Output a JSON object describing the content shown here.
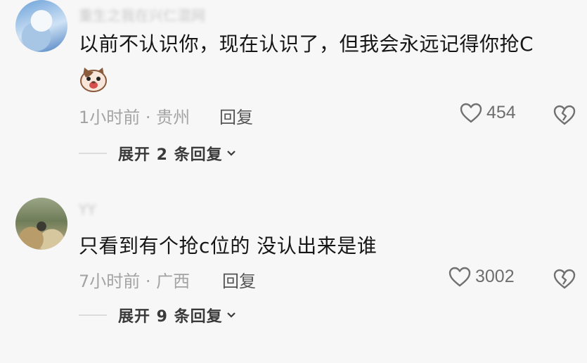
{
  "comments": [
    {
      "username": "重生之我在兴仁混网",
      "text": "以前不认识你，现在认识了，但我会永远记得你抢C",
      "has_emoji": true,
      "meta": "1小时前 · 贵州",
      "reply_label": "回复",
      "like_count": "454",
      "expand_label": "展开 2 条回复"
    },
    {
      "username": "YY",
      "text": "只看到有个抢c位的 没认出来是谁",
      "has_emoji": false,
      "meta": "7小时前 · 广西",
      "reply_label": "回复",
      "like_count": "3002",
      "expand_label": "展开 9 条回复"
    }
  ],
  "icons": {
    "like": "heart-outline-icon",
    "dislike": "broken-heart-icon",
    "expand": "chevron-down-icon",
    "emoji": "cat-face-emoji-icon"
  },
  "colors": {
    "background": "#f7f7f7",
    "text": "#161616",
    "meta": "#a3a3a3",
    "icon": "#707070"
  }
}
